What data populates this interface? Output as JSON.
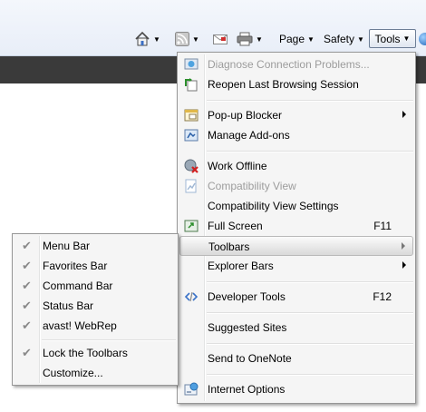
{
  "command_bar": {
    "page_label": "Page",
    "safety_label": "Safety",
    "tools_label": "Tools"
  },
  "tools_menu": {
    "items": [
      {
        "label": "Diagnose Connection Problems...",
        "disabled": true
      },
      {
        "label": "Reopen Last Browsing Session"
      },
      {
        "label": "Pop-up Blocker",
        "submenu": true
      },
      {
        "label": "Manage Add-ons"
      },
      {
        "label": "Work Offline"
      },
      {
        "label": "Compatibility View",
        "disabled": true
      },
      {
        "label": "Compatibility View Settings"
      },
      {
        "label": "Full Screen",
        "shortcut": "F11"
      },
      {
        "label": "Toolbars",
        "submenu": true,
        "highlighted": true
      },
      {
        "label": "Explorer Bars",
        "submenu": true
      },
      {
        "label": "Developer Tools",
        "shortcut": "F12"
      },
      {
        "label": "Suggested Sites"
      },
      {
        "label": "Send to OneNote"
      },
      {
        "label": "Internet Options"
      }
    ]
  },
  "toolbars_menu": {
    "items": [
      {
        "label": "Menu Bar",
        "checked": true
      },
      {
        "label": "Favorites Bar",
        "checked": true
      },
      {
        "label": "Command Bar",
        "checked": true
      },
      {
        "label": "Status Bar",
        "checked": true
      },
      {
        "label": "avast! WebRep",
        "checked": true
      },
      {
        "label": "Lock the Toolbars",
        "checked": true
      },
      {
        "label": "Customize..."
      }
    ]
  },
  "colors": {
    "menu_bg": "#f5f5f5",
    "menu_border": "#979797",
    "disabled_text": "#9c9c9c",
    "dark_strip": "#3a3a3a"
  }
}
